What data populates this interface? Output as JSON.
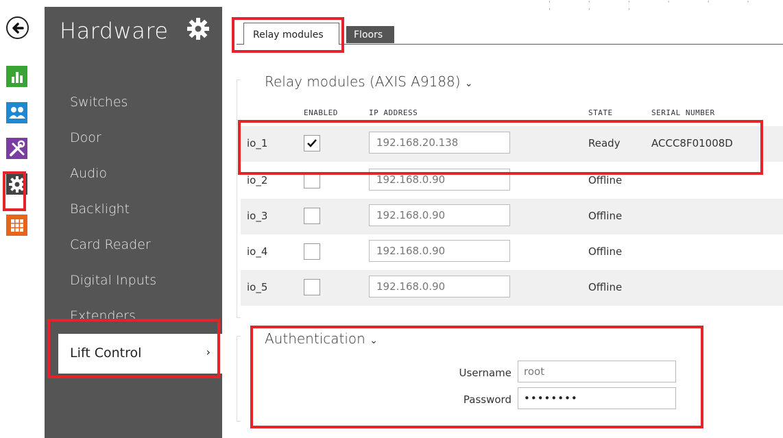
{
  "sidebar": {
    "title": "Hardware",
    "items": [
      {
        "label": "Switches"
      },
      {
        "label": "Door"
      },
      {
        "label": "Audio"
      },
      {
        "label": "Backlight"
      },
      {
        "label": "Card Reader"
      },
      {
        "label": "Digital Inputs"
      },
      {
        "label": "Extenders"
      }
    ],
    "active": {
      "label": "Lift Control",
      "chevron": "›"
    }
  },
  "icon_strip": {
    "back": "←",
    "icons": [
      "chart-icon",
      "users-icon",
      "tools-icon",
      "gear-icon",
      "grid-icon"
    ],
    "colors": {
      "chart": "#3aa335",
      "users": "#1e88d2",
      "tools": "#7a3ea0",
      "gear": "#444444",
      "grid": "#e8641c"
    }
  },
  "tabs": [
    {
      "label": "Relay modules",
      "active": true
    },
    {
      "label": "Floors",
      "active": false
    }
  ],
  "relay_section": {
    "title": "Relay modules (AXIS A9188)",
    "chevron": "⌄",
    "columns": {
      "enabled": "ENABLED",
      "ip": "IP ADDRESS",
      "state": "STATE",
      "serial": "SERIAL NUMBER"
    },
    "rows": [
      {
        "name": "io_1",
        "enabled": true,
        "ip": "192.168.20.138",
        "state": "Ready",
        "serial": "ACCC8F01008D"
      },
      {
        "name": "io_2",
        "enabled": false,
        "ip": "192.168.0.90",
        "state": "Offline",
        "serial": ""
      },
      {
        "name": "io_3",
        "enabled": false,
        "ip": "192.168.0.90",
        "state": "Offline",
        "serial": ""
      },
      {
        "name": "io_4",
        "enabled": false,
        "ip": "192.168.0.90",
        "state": "Offline",
        "serial": ""
      },
      {
        "name": "io_5",
        "enabled": false,
        "ip": "192.168.0.90",
        "state": "Offline",
        "serial": ""
      }
    ]
  },
  "auth_section": {
    "title": "Authentication",
    "chevron": "⌄",
    "username_label": "Username",
    "username_value": "root",
    "password_label": "Password",
    "password_value": "••••••••"
  },
  "colors": {
    "sidebar_bg": "#555555",
    "highlight": "#e3242b",
    "row_alt": "#f0f0f0"
  }
}
